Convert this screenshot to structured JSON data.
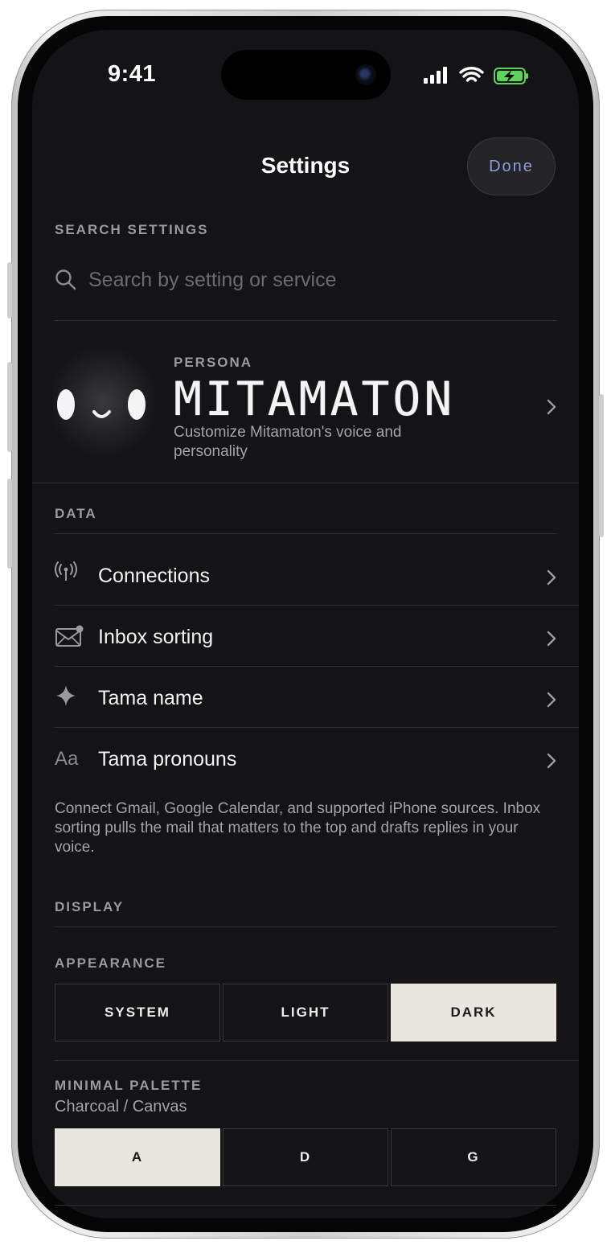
{
  "status_bar": {
    "time": "9:41"
  },
  "header": {
    "title": "Settings",
    "done_label": "Done"
  },
  "search": {
    "section_label": "SEARCH SETTINGS",
    "placeholder": "Search by setting or service",
    "value": ""
  },
  "persona": {
    "label": "PERSONA",
    "name": "MITAMATON",
    "description": "Customize Mitamaton's voice and personality"
  },
  "data_section": {
    "label": "DATA",
    "rows": [
      {
        "label": "Connections",
        "icon": "antenna-icon"
      },
      {
        "label": "Inbox sorting",
        "icon": "mail-badge-icon"
      },
      {
        "label": "Tama name",
        "icon": "sparkle-icon"
      },
      {
        "label": "Tama pronouns",
        "icon": "text-aa-icon",
        "icon_text": "Aa"
      }
    ],
    "help_text": "Connect Gmail, Google Calendar, and supported iPhone sources. Inbox sorting pulls the mail that matters to the top and drafts replies in your voice."
  },
  "display_section": {
    "label": "DISPLAY",
    "appearance": {
      "label": "APPEARANCE",
      "options": [
        "SYSTEM",
        "LIGHT",
        "DARK"
      ],
      "selected": "DARK"
    },
    "palette": {
      "label": "MINIMAL PALETTE",
      "current": "Charcoal / Canvas",
      "options": [
        "A",
        "D",
        "G"
      ],
      "selected": "A"
    }
  },
  "colors": {
    "background": "#141416",
    "accent_done": "#8f9be0",
    "selected_segment": "#e9e6df",
    "battery_green": "#5fd35a"
  }
}
